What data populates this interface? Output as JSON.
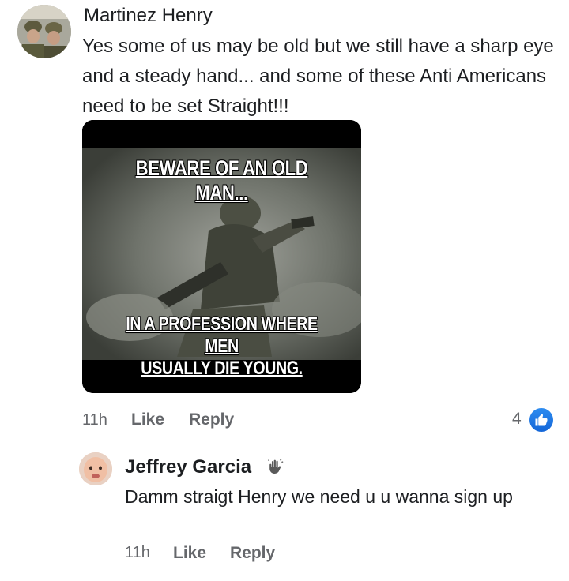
{
  "comment": {
    "author": "Martinez Henry",
    "text": "Yes some of us may be old but we still have a sharp eye and a steady hand... and some of these Anti Americans need to be set Straight!!!",
    "meme": {
      "top_text": "BEWARE OF AN OLD MAN...",
      "bottom_text_line1": "IN A PROFESSION WHERE MEN",
      "bottom_text_line2": "USUALLY DIE YOUNG."
    },
    "time": "11h",
    "like_label": "Like",
    "reply_label": "Reply",
    "reaction_count": "4",
    "reaction_icon": "like-icon"
  },
  "reply": {
    "author": "Jeffrey Garcia",
    "badge_icon": "wave-icon",
    "text": "Damm straigt Henry we need u u wanna sign up",
    "time": "11h",
    "like_label": "Like",
    "reply_label": "Reply"
  },
  "colors": {
    "text": "#1c1e21",
    "meta": "#65676b",
    "like_blue": "#1877f2"
  }
}
